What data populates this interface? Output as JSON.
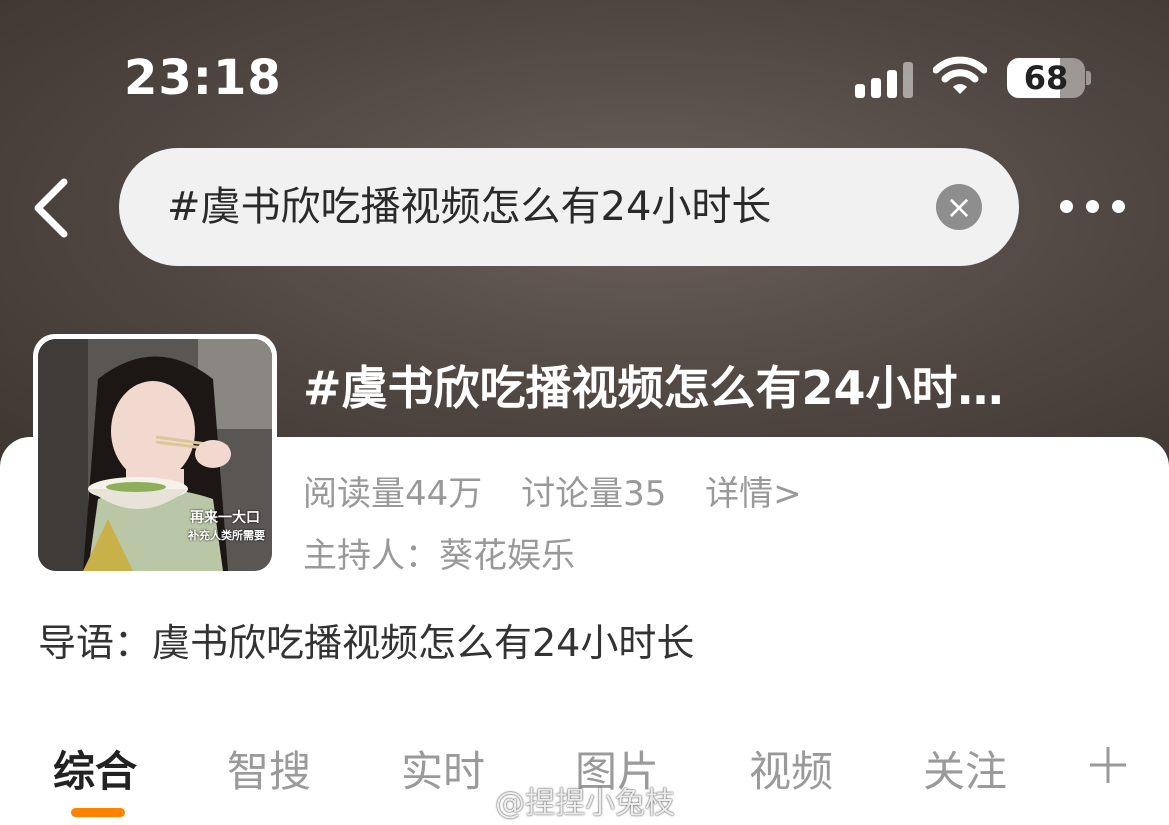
{
  "status_bar": {
    "time": "23:18",
    "battery": "68",
    "battery_fraction": 0.68
  },
  "search": {
    "query": "#虞书欣吃播视频怎么有24小时长",
    "clear_icon": "close-circle-icon"
  },
  "nav": {
    "back_icon": "chevron-left-icon",
    "more_icon": "more-horizontal-icon"
  },
  "topic": {
    "title": "#虞书欣吃播视频怎么有24小时…",
    "read_count": "阅读量44万",
    "discuss_count": "讨论量35",
    "detail_link": "详情>",
    "host": "主持人：葵花娱乐",
    "intro": "导语：虞书欣吃播视频怎么有24小时长",
    "cover_caption_line1": "再来一大口",
    "cover_caption_line2": "补充人类所需要"
  },
  "tabs": [
    {
      "label": "综合",
      "active": true
    },
    {
      "label": "智搜",
      "active": false
    },
    {
      "label": "实时",
      "active": false
    },
    {
      "label": "图片",
      "active": false
    },
    {
      "label": "视频",
      "active": false
    },
    {
      "label": "关注",
      "active": false
    }
  ],
  "tab_plus_icon": "plus-icon",
  "watermark": "@捏捏小兔枝",
  "colors": {
    "accent": "#ff8200",
    "hero_bg": "#4f4641",
    "muted_text": "#999999"
  }
}
